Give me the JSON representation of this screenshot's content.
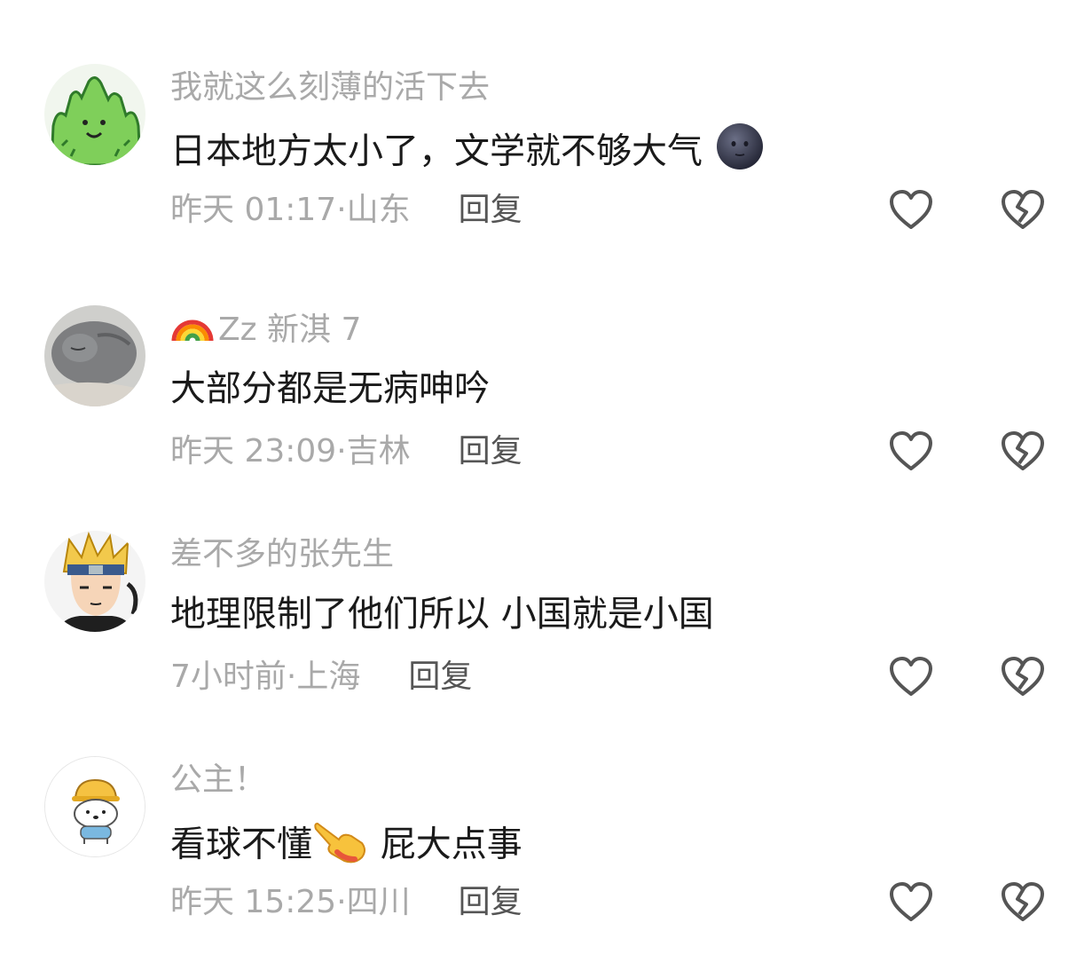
{
  "comments": [
    {
      "username": "我就这么刻薄的活下去",
      "content": "日本地方太小了，文学就不够大气",
      "content_emoji": "new-moon-face",
      "time": "昨天 01:17",
      "location": "山东",
      "reply_label": "回复",
      "avatar": "green-cactus-creature"
    },
    {
      "username": "Zz 新淇 7",
      "badge": "rainbow",
      "content": "大部分都是无病呻吟",
      "time": "昨天 23:09",
      "location": "吉林",
      "reply_label": "回复",
      "avatar": "sleeping-gray-cat"
    },
    {
      "username": "差不多的张先生",
      "content": "地理限制了他们所以 小国就是小国",
      "time": "7小时前",
      "location": "上海",
      "reply_label": "回复",
      "avatar": "anime-ninja-boy"
    },
    {
      "username": "公主！",
      "content_before": "看球不懂",
      "content_emoji": "pointing-hand",
      "content_after": " 屁大点事",
      "time": "昨天 15:25",
      "location": "四川",
      "reply_label": "回复",
      "avatar": "cartoon-dog-hardhat"
    }
  ],
  "meta_separator": "·",
  "colors": {
    "username": "#a9a9a9",
    "content": "#1a1a1a",
    "meta": "#a9a9a9",
    "reply": "#555555",
    "icon_stroke": "#555555"
  }
}
